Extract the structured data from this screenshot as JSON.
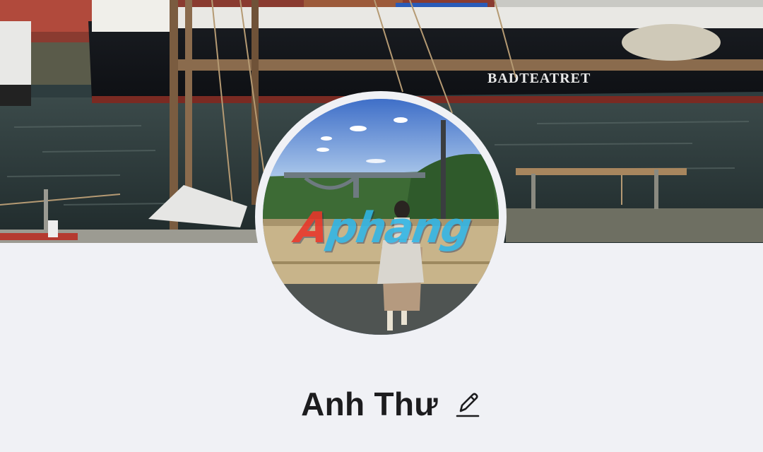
{
  "profile": {
    "name": "Anh Thư",
    "edit_icon": "pencil-icon"
  },
  "cover_photo": {
    "description_text": "BADTEATRET"
  },
  "avatar": {
    "watermark_accent": "A",
    "watermark_rest": "phang"
  },
  "colors": {
    "background": "#f0f1f5",
    "name_text": "#1c1c1e",
    "avatar_ring": "#f0f1f5"
  }
}
